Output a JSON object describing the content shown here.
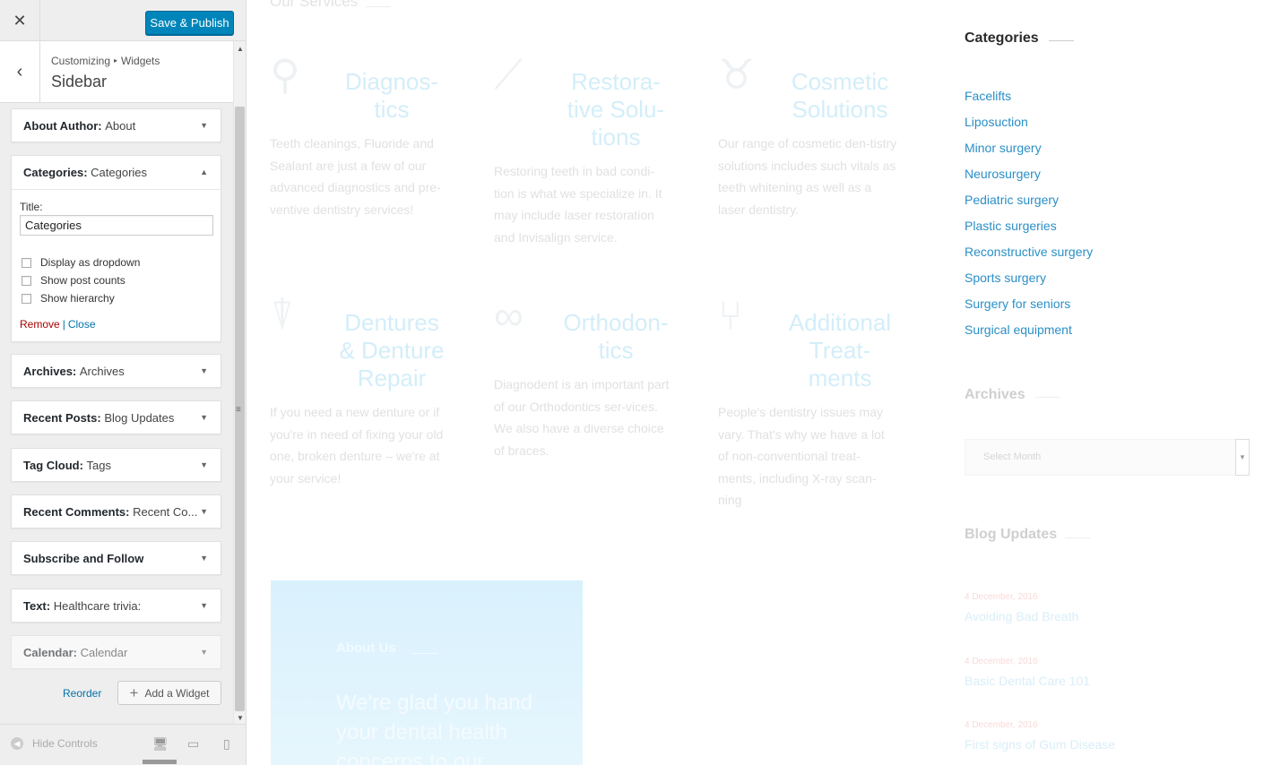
{
  "customizer": {
    "close_icon": "✕",
    "publish_label": "Save & Publish",
    "back_icon": "‹",
    "breadcrumb": {
      "parent": "Customizing",
      "separator": "▸",
      "current": "Widgets"
    },
    "section_title": "Sidebar",
    "widgets": [
      {
        "label": "About Author:",
        "sub": "About"
      },
      {
        "label": "Categories:",
        "sub": "Categories"
      },
      {
        "label": "Archives:",
        "sub": "Archives"
      },
      {
        "label": "Recent Posts:",
        "sub": "Blog Updates"
      },
      {
        "label": "Tag Cloud:",
        "sub": "Tags"
      },
      {
        "label": "Recent Comments:",
        "sub": "Recent Co..."
      },
      {
        "label": "Subscribe and Follow",
        "sub": ""
      },
      {
        "label": "Text:",
        "sub": "Healthcare trivia:"
      },
      {
        "label": "Calendar:",
        "sub": "Calendar"
      }
    ],
    "categories_form": {
      "title_label": "Title:",
      "title_value": "Categories",
      "checkboxes": [
        "Display as dropdown",
        "Show post counts",
        "Show hierarchy"
      ],
      "remove_label": "Remove",
      "separator": "|",
      "close_label": "Close"
    },
    "reorder_label": "Reorder",
    "add_widget_label": "Add a Widget",
    "hide_controls_label": "Hide Controls"
  },
  "preview": {
    "services_heading": "Our Services",
    "services": [
      {
        "title": "Diagnos-tics",
        "text": "Teeth cleanings, Fluoride and Sealant are just a few of our advanced diagnostics and pre-ventive dentistry services!"
      },
      {
        "title": "Restora-tive Solu-tions",
        "text": "Restoring teeth in bad condi-tion is what we specialize in. It may include laser restoration and Invisalign service."
      },
      {
        "title": "Cosmetic Solutions",
        "text": "Our range of cosmetic den-tistry solutions includes such vitals as teeth whitening as well as a laser dentistry."
      },
      {
        "title": "Dentures & Denture Repair",
        "text": "If you need a new denture or if you're in need of fixing your old one, broken denture – we're at your service!"
      },
      {
        "title": "Orthodon-tics",
        "text": "Diagnodent is an important part of our Orthodontics ser-vices. We also have a diverse choice of braces."
      },
      {
        "title": "Additional Treat-ments",
        "text": "People's dentistry issues may vary. That's why we have a lot of non-conventional treat-ments, including X-ray scan-ning"
      }
    ],
    "about": {
      "label": "About Us",
      "text": "We're glad you hand your dental health concerns to our"
    },
    "categories_heading": "Categories",
    "categories": [
      "Facelifts",
      "Liposuction",
      "Minor surgery",
      "Neurosurgery",
      "Pediatric surgery",
      "Plastic surgeries",
      "Reconstructive surgery",
      "Sports surgery",
      "Surgery for seniors",
      "Surgical equipment"
    ],
    "archives_heading": "Archives",
    "archives_select": "Select Month",
    "blog_heading": "Blog Updates",
    "posts": [
      {
        "date": "4 December, 2016",
        "title": "Avoiding Bad Breath"
      },
      {
        "date": "4 December, 2016",
        "title": "Basic Dental Care 101"
      },
      {
        "date": "4 December, 2016",
        "title": "First signs of Gum Disease"
      }
    ],
    "colors": {
      "link": "#2a8fc7",
      "publish": "#0085ba",
      "remove": "#aa0000"
    }
  }
}
